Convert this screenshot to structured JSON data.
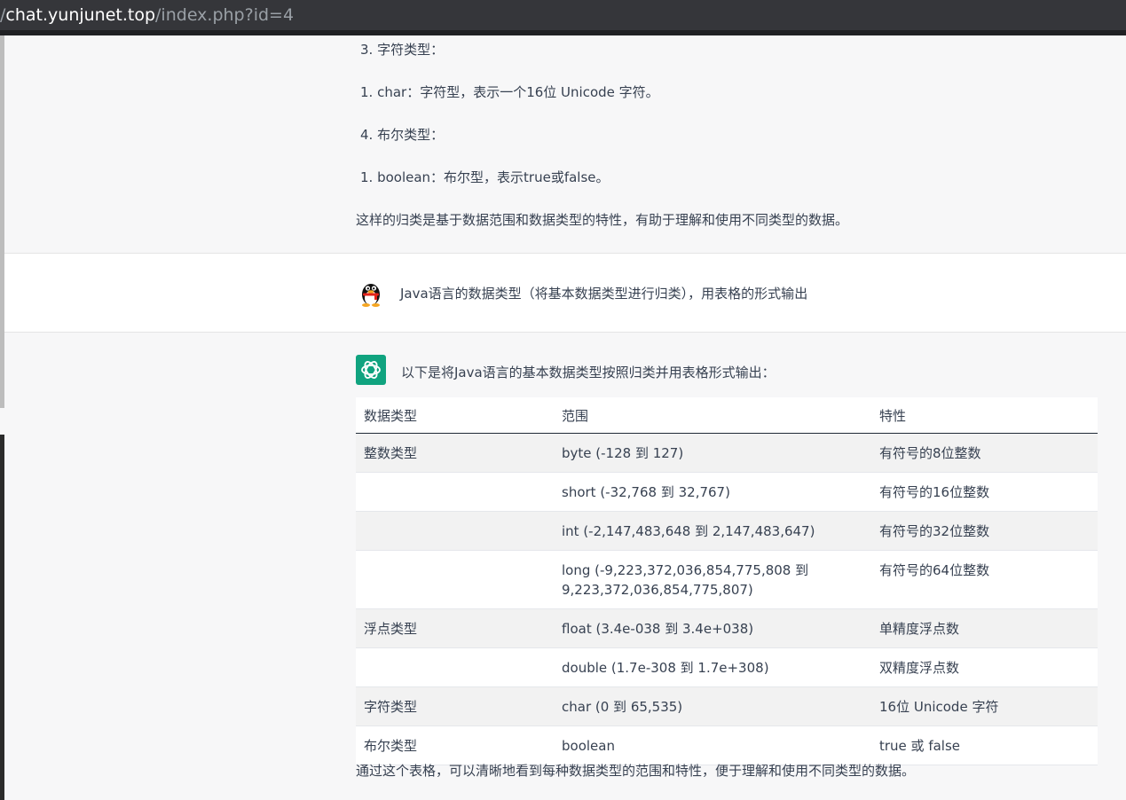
{
  "browser": {
    "url_prefix": "/",
    "url_host": "chat.yunjunet.top",
    "url_path": "/index.php?id=4"
  },
  "previous_answer": {
    "lines": [
      "3. 字符类型：",
      "1. char：字符型，表示一个16位 Unicode 字符。",
      "4. 布尔类型：",
      "1. boolean：布尔型，表示true或false。",
      "这样的归类是基于数据范围和数据类型的特性，有助于理解和使用不同类型的数据。"
    ]
  },
  "user_message": {
    "avatar_icon": "qq-penguin-icon",
    "text": "Java语言的数据类型（将基本数据类型进行归类），用表格的形式输出"
  },
  "assistant_message": {
    "avatar_icon": "openai-logo-icon",
    "accent_color": "#10a37f",
    "intro": "以下是将Java语言的基本数据类型按照归类并用表格形式输出：",
    "table": {
      "headers": [
        "数据类型",
        "范围",
        "特性"
      ],
      "rows": [
        [
          "整数类型",
          "byte (-128 到 127)",
          "有符号的8位整数"
        ],
        [
          "",
          "short (-32,768 到 32,767)",
          "有符号的16位整数"
        ],
        [
          "",
          "int (-2,147,483,648 到 2,147,483,647)",
          "有符号的32位整数"
        ],
        [
          "",
          "long (-9,223,372,036,854,775,808 到 9,223,372,036,854,775,807)",
          "有符号的64位整数"
        ],
        [
          "浮点类型",
          "float (3.4e-038 到 3.4e+038)",
          "单精度浮点数"
        ],
        [
          "",
          "double (1.7e-308 到 1.7e+308)",
          "双精度浮点数"
        ],
        [
          "字符类型",
          "char (0 到 65,535)",
          "16位 Unicode 字符"
        ],
        [
          "布尔类型",
          "boolean",
          "true 或 false"
        ]
      ]
    },
    "outro": "通过这个表格，可以清晰地看到每种数据类型的范围和特性，便于理解和使用不同类型的数据。"
  }
}
